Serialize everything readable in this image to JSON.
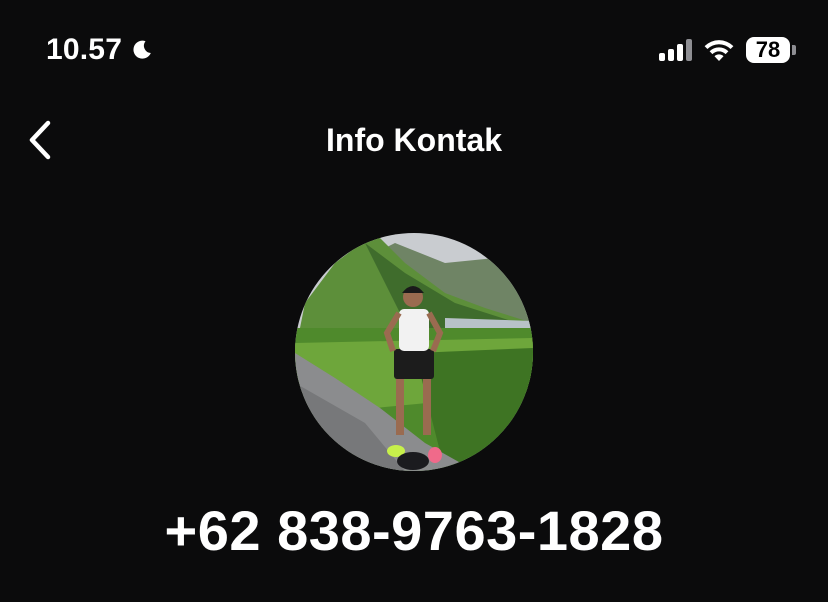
{
  "status_bar": {
    "time": "10.57",
    "battery_level": "78",
    "icons": [
      "moon-icon",
      "signal-icon",
      "wifi-icon",
      "battery-icon"
    ]
  },
  "nav": {
    "title": "Info Kontak",
    "back_icon": "chevron-left-icon"
  },
  "contact": {
    "phone_number": "+62 838-9763-1828"
  },
  "colors": {
    "background": "#0b0b0c",
    "text": "#ffffff"
  }
}
